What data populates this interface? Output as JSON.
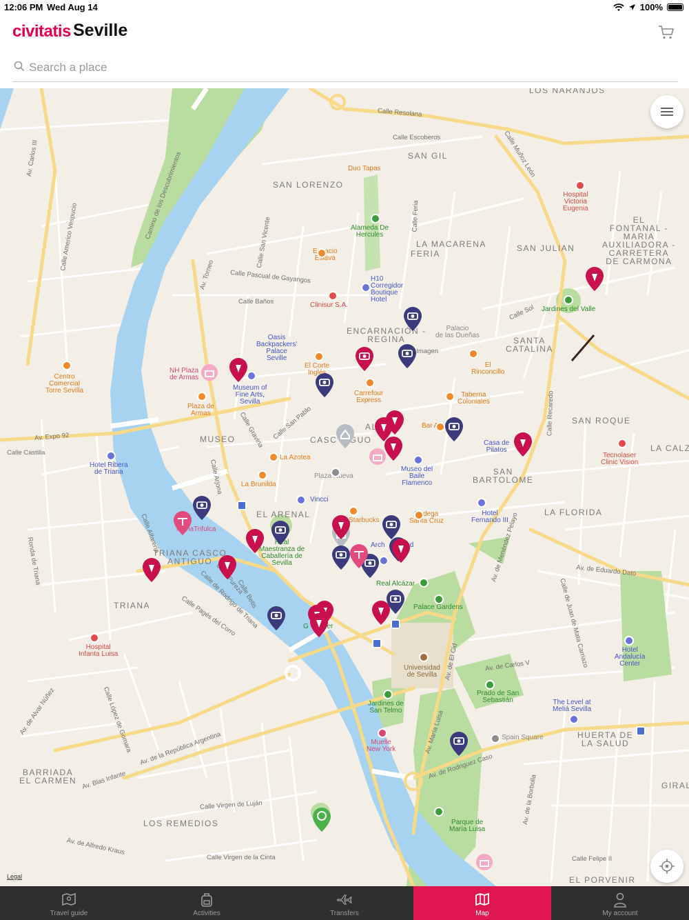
{
  "status_bar": {
    "time": "12:06 PM",
    "date": "Wed Aug 14",
    "battery": "100%"
  },
  "header": {
    "logo": "civitatis",
    "city": "Seville"
  },
  "search": {
    "placeholder": "Search a place"
  },
  "map": {
    "legal": "Legal",
    "districts": {
      "los_naranjos": "LOS NARANJOS",
      "san_gil": "SAN GIL",
      "san_lorenzo": "SAN LORENZO",
      "el_fontanal": "EL\nFONTANAL -\nMARIA\nAUXILIADORA -\nCARRETERA\nDE CARMONA",
      "la_macarena": "LA MACARENA",
      "feria": "FERIA",
      "san_julian": "SAN JULIAN",
      "encarnacion": "ENCARNACIÓN -\nREGINA",
      "santa_catalina": "SANTA\nCATALINA",
      "san_roque": "SAN ROQUE",
      "la_calzada": "LA CALZ",
      "museo": "MUSEO",
      "casco_antiguo": "CASC  TIGUO",
      "alfalfa": "AL",
      "san_bartolome": "SAN\nBARTOLOME",
      "la_florida": "LA FLORIDA",
      "el_arenal": "EL ARENAL",
      "triana_casco": "TRIANA CASCO\nANTIGUO",
      "triana": "TRIANA",
      "huerta_salud": "HUERTA DE\nLA SALUD",
      "giral": "GIRAL",
      "barriada_carmen": "BARRIADA\nEL CARMEN",
      "los_remedios": "LOS REMEDIOS",
      "el_porvenir": "EL PORVENIR"
    },
    "streets": {
      "resolana": "Calle Resolana",
      "escoberos": "Calle Escoberos",
      "munoz_leon": "Calle Muñoz León",
      "carlos3": "Av. Carlos III",
      "descubrimientos": "Camino de los Descubrimientos",
      "americo": "Calle Americo Vespucio",
      "torneo": "Av. Torneo",
      "san_vicente": "Calle San Vicente",
      "gayangos": "Calle Pascual de Gayangos",
      "banos": "Calle Baños",
      "feria": "Calle Feria",
      "sol": "Calle Sol",
      "imagen": "Calle Imagen",
      "recaredo": "Calle Recaredo",
      "expo92": "Av. Expo 92",
      "castilla": "Calle Castilla",
      "arjona": "Calle Arjona",
      "gravina": "Calle Gravina",
      "san_pablo": "Calle San Pablo",
      "menendez": "Av. de Menéndez Pelayo",
      "eduardo_dato": "Av. de Eduardo Dato",
      "pages_corro": "Calle Pagés del Corro",
      "betis": "Calle Betis",
      "pureza": "Calle Pureza",
      "rodrigo": "Calle de Rodrigo de Triana",
      "alfareria": "Calle Alfarería",
      "ronda_triana": "Ronda de Triana",
      "lopez_gomara": "Calle López de Gomara",
      "republica": "Av. de la República Argentina",
      "alvar": "Av. de Alvar Núñez",
      "blas_infante": "Av. Blas Infante",
      "el_cid": "Av. de El Cid",
      "carlos5": "Av. de Carlos V",
      "maria_luisa": "Av. María Luisa",
      "rodriguez_caso": "Av. de Rodriguez Caso",
      "borbolla": "Av. de la Borbolla",
      "mata": "Calle de Juan de Mata Carriazo",
      "virgen_lujan": "Calle Virgen de Luján",
      "alfredo": "Av. de Alfredo Kraus",
      "virgen_cinta": "Calle Virgen de la Cinta",
      "felipe2": "Calle Felipe II"
    },
    "pois": {
      "duo_tapas": "Duo Tapas",
      "hospital_victoria": "Hospital\nVictoria\nEugenia",
      "alameda": "Alameda De\nHercules",
      "espacio_eslava": "Espacio\nEslava",
      "h10": "H10\nCorregidor\nBoutique\nHotel",
      "clinisur": "Clinisur S.A.",
      "jardines_valle": "Jardines del Valle",
      "palacio_duenas": "Palacio\nde las Dueñas",
      "oasis": "Oasis\nBackpackers'\nPalace\nSeville",
      "el_corte": "El Corte\nInglés",
      "el_rinconcillo": "El\nRinconcillo",
      "nh_plaza": "NH Plaza\nde Armas",
      "centro_torre": "Centro\nComercial\nTorre Sevilla",
      "museum_fine_arts": "Museum of\nFine Arts,\nSevilla",
      "carrefour": "Carrefour\nExpress",
      "taberna": "Taberna\nColoniales",
      "plaza_armas": "Plaza de\nArmas",
      "bar_alfalfa": "Bar Alf",
      "casa_pilatos": "Casa de\nPilatos",
      "tecnolaser": "Tecnolaser\nClinic Vision",
      "la_azotea": "La Azotea",
      "hotel_ribera": "Hotel Ribera\nde Triana",
      "plaza_nueva": "Plaza Nueva",
      "museo_baile": "Museo del\nBaile\nFlamenco",
      "la_brunilda": "La Brunilda",
      "vincci": "Vincci",
      "hotel_fernando": "Hotel\nFernando III",
      "starbucks": "Starbucks",
      "bodega": "Bodega\nSanta Cruz",
      "mariatrifulca": "MariaTrifulca",
      "real_maestranza": "Real\nMaestranza de\nCaballería de\nSevilla",
      "archivo": "Arch     de Ind",
      "real_alcazar": "Real Alcázar",
      "palace_gardens": "Palace Gardens",
      "gold_tower": "G     ower",
      "hospital_infanta": "Hospital\nInfanta Luisa",
      "hotel_andalucia": "Hotel\nAndalucía\nCenter",
      "universidad": "Universidad\nde Sevilla",
      "prado": "Prado de San\nSebastián",
      "the_level": "The Level at\nMeliá Sevilla",
      "jardines_telmo": "Jardines de\nSan Telmo",
      "muelle": "Muelle\nNew York",
      "spain_square": "Spain Square",
      "parque_maria_luisa": "Parque de\nMaría Luisa"
    }
  },
  "tabs": [
    {
      "label": "Travel guide",
      "icon": "map-book-icon",
      "active": false
    },
    {
      "label": "Activities",
      "icon": "backpack-icon",
      "active": false
    },
    {
      "label": "Transfers",
      "icon": "plane-icon",
      "active": false
    },
    {
      "label": "Map",
      "icon": "map-icon",
      "active": true
    },
    {
      "label": "My account",
      "icon": "person-icon",
      "active": false
    }
  ],
  "colors": {
    "brand": "#e5004b",
    "tab_active": "#e0174f",
    "pin_red": "#c8104f",
    "pin_navy": "#3b3a7a",
    "river": "#a8d3f0",
    "park": "#b9dca0",
    "map_bg": "#f3efe6",
    "road_major": "#f7d98a"
  }
}
